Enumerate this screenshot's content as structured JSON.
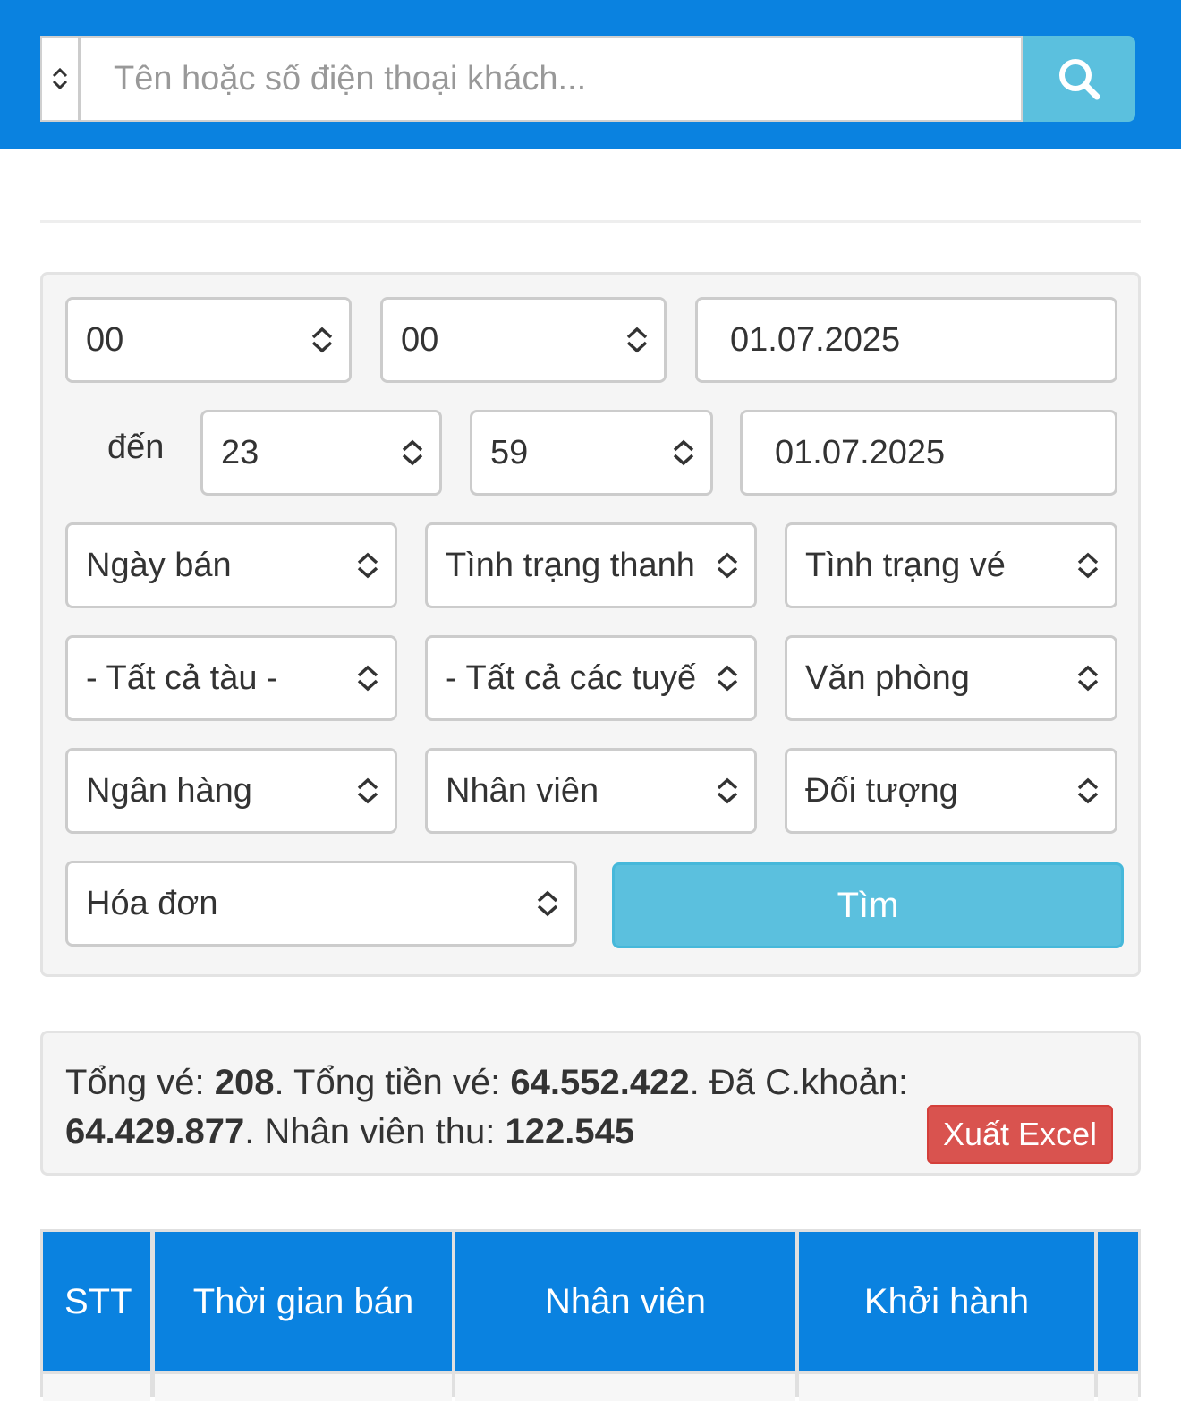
{
  "search": {
    "placeholder": "Tên hoặc số điện thoại khách...",
    "type_icon": "updown-chevron-icon",
    "button_icon": "search-icon"
  },
  "filters": {
    "from_hour": "00",
    "from_minute": "00",
    "from_date": "01.07.2025",
    "to_label": "đến",
    "to_hour": "23",
    "to_minute": "59",
    "to_date": "01.07.2025",
    "date_type": "Ngày bán",
    "payment_status": "Tình trạng thanh",
    "ticket_status": "Tình trạng vé",
    "train": "- Tất cả tàu -",
    "route": "- Tất cả các tuyế",
    "office": "Văn phòng",
    "bank": "Ngân hàng",
    "staff": "Nhân viên",
    "target": "Đối tượng",
    "invoice": "Hóa đơn",
    "find_button": "Tìm"
  },
  "summary": {
    "total_tickets_label": "Tổng vé: ",
    "total_tickets": "208",
    "total_amount_label": ". Tổng tiền vé: ",
    "total_amount": "64.552.422",
    "transferred_label": ". Đã C.khoản:",
    "transferred": "64.429.877",
    "staff_collected_label": ". Nhân viên thu: ",
    "staff_collected": "122.545",
    "export_button": "Xuất Excel"
  },
  "table": {
    "columns": [
      "STT",
      "Thời gian bán",
      "Nhân viên",
      "Khởi hành",
      ""
    ]
  },
  "colors": {
    "header_blue": "#0a82e0",
    "info_button": "#5bc0de",
    "danger_button": "#d9534f"
  }
}
